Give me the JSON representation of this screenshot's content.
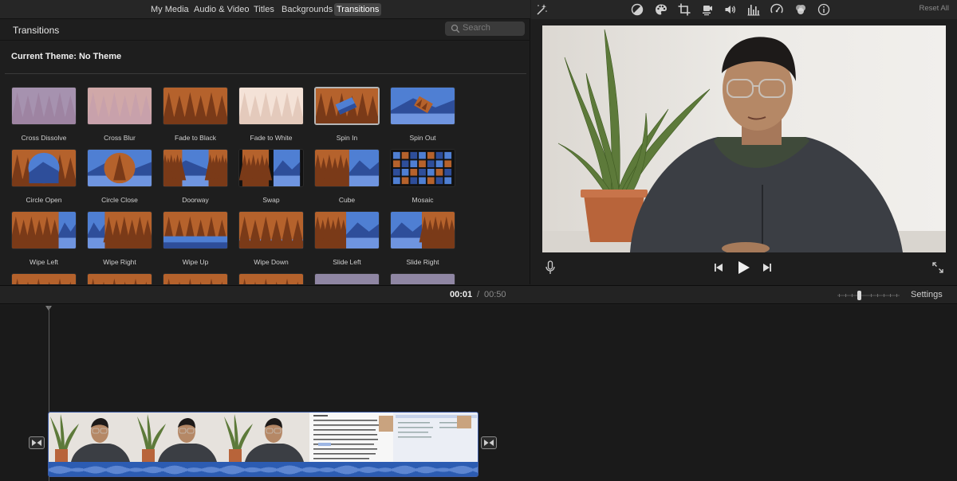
{
  "browser": {
    "tabs": [
      {
        "label": "My Media"
      },
      {
        "label": "Audio & Video"
      },
      {
        "label": "Titles"
      },
      {
        "label": "Backgrounds"
      },
      {
        "label": "Transitions"
      }
    ],
    "active_tab": "Transitions",
    "title": "Transitions",
    "search_placeholder": "Search",
    "theme_label": "Current Theme: No Theme",
    "transitions": [
      {
        "label": "Cross Dissolve",
        "style": "dissolve"
      },
      {
        "label": "Cross Blur",
        "style": "blur"
      },
      {
        "label": "Fade to Black",
        "style": "forest"
      },
      {
        "label": "Fade to White",
        "style": "white"
      },
      {
        "label": "Spin In",
        "style": "spin",
        "selected": true
      },
      {
        "label": "Spin Out",
        "style": "spinout"
      },
      {
        "label": "Circle Open",
        "style": "circleopen"
      },
      {
        "label": "Circle Close",
        "style": "circleclose"
      },
      {
        "label": "Doorway",
        "style": "doorway"
      },
      {
        "label": "Swap",
        "style": "swap"
      },
      {
        "label": "Cube",
        "style": "cube"
      },
      {
        "label": "Mosaic",
        "style": "mosaic"
      },
      {
        "label": "Wipe Left",
        "style": "wipeleft"
      },
      {
        "label": "Wipe Right",
        "style": "wiperight"
      },
      {
        "label": "Wipe Up",
        "style": "wipeup"
      },
      {
        "label": "Wipe Down",
        "style": "wipedown"
      },
      {
        "label": "Slide Left",
        "style": "slideleft"
      },
      {
        "label": "Slide Right",
        "style": "slideright"
      },
      {
        "label": "",
        "style": "forest"
      },
      {
        "label": "",
        "style": "forest"
      },
      {
        "label": "",
        "style": "forest"
      },
      {
        "label": "",
        "style": "wipeup"
      },
      {
        "label": "",
        "style": "purple"
      },
      {
        "label": "",
        "style": "purple"
      }
    ]
  },
  "viewer": {
    "toolbar_icons": [
      "magic-wand-icon",
      "color-balance-icon",
      "color-palette-icon",
      "crop-icon",
      "stabilization-icon",
      "volume-icon",
      "equalizer-icon",
      "speed-icon",
      "clip-filter-icon",
      "info-icon"
    ],
    "reset_label": "Reset All"
  },
  "timeline": {
    "current_time": "00:01",
    "separator": "/",
    "total_time": "00:50",
    "settings_label": "Settings"
  },
  "colors": {
    "background": "#1e1e1e",
    "active_tab": "#454545",
    "clip_blue": "#2c5cb2",
    "forest_orange": "#c46a2c",
    "sky_blue": "#3d6dc9"
  }
}
